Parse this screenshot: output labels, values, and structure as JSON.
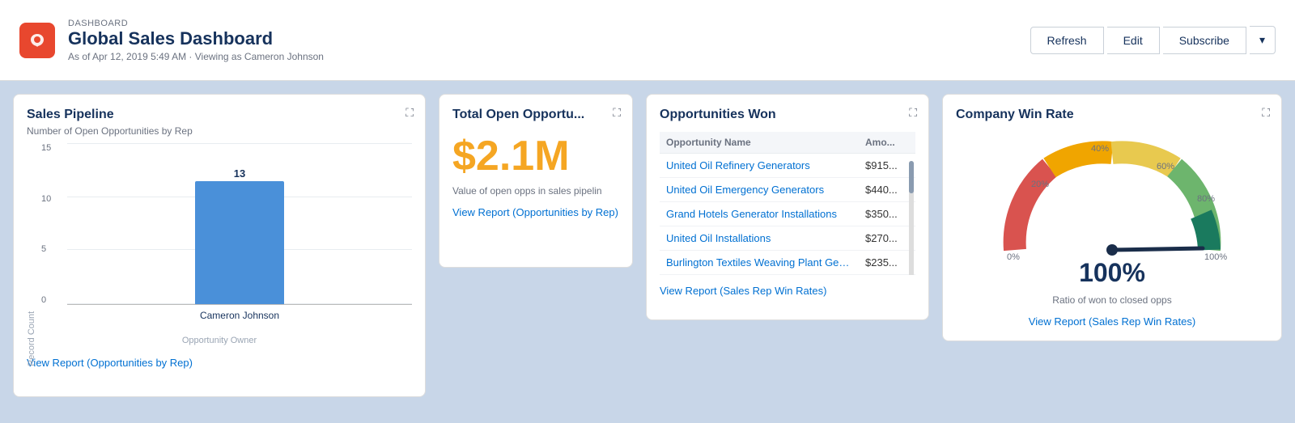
{
  "header": {
    "app_label": "DASHBOARD",
    "title": "Global Sales Dashboard",
    "subtitle": "As of Apr 12, 2019 5:49 AM · Viewing as Cameron Johnson",
    "refresh_label": "Refresh",
    "edit_label": "Edit",
    "subscribe_label": "Subscribe"
  },
  "pipeline_card": {
    "title": "Sales Pipeline",
    "subtitle": "Number of Open Opportunities by Rep",
    "y_labels": [
      "15",
      "10",
      "5",
      "0"
    ],
    "bar_value": "13",
    "bar_person": "Cameron Johnson",
    "x_axis_title": "Opportunity Owner",
    "y_axis_title": "Record Count",
    "view_report": "View Report (Opportunities by Rep)"
  },
  "total_opps_card": {
    "title": "Total Open Opportu...",
    "amount": "$2.1M",
    "description": "Value of open opps in sales pipelin",
    "view_report": "View Report (Opportunities by Rep)"
  },
  "opps_won_card": {
    "title": "Opportunities Won",
    "col_name": "Opportunity Name",
    "col_amount": "Amo...",
    "rows": [
      {
        "name": "United Oil Refinery Generators",
        "amount": "$915..."
      },
      {
        "name": "United Oil Emergency Generators",
        "amount": "$440..."
      },
      {
        "name": "Grand Hotels Generator Installations",
        "amount": "$350..."
      },
      {
        "name": "United Oil Installations",
        "amount": "$270..."
      },
      {
        "name": "Burlington Textiles Weaving Plant Gen...",
        "amount": "$235..."
      }
    ],
    "view_report": "View Report (Sales Rep Win Rates)"
  },
  "win_rate_card": {
    "title": "Company Win Rate",
    "value": "100%",
    "description": "Ratio of won to closed opps",
    "view_report": "View Report (Sales Rep Win Rates)",
    "gauge_labels": [
      "0%",
      "20%",
      "40%",
      "60%",
      "80%",
      "100%"
    ]
  }
}
